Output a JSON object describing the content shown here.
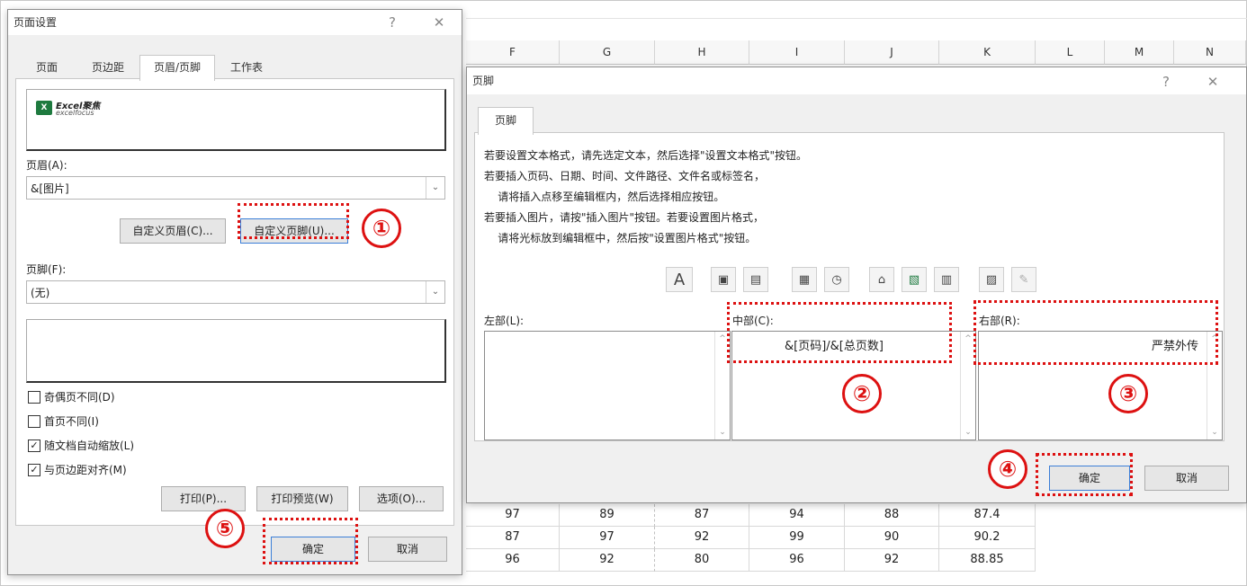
{
  "spreadsheet": {
    "columns": [
      "F",
      "G",
      "H",
      "I",
      "J",
      "K",
      "L",
      "M",
      "N"
    ],
    "rows": [
      [
        "97",
        "89",
        "87",
        "94",
        "88",
        "87.4"
      ],
      [
        "87",
        "97",
        "92",
        "99",
        "90",
        "90.2"
      ],
      [
        "96",
        "92",
        "80",
        "96",
        "92",
        "88.85"
      ]
    ]
  },
  "page_setup": {
    "title": "页面设置",
    "help": "?",
    "close": "✕",
    "tabs": [
      "页面",
      "页边距",
      "页眉/页脚",
      "工作表"
    ],
    "active_tab": "页眉/页脚",
    "logo_text": "Excel聚焦",
    "logo_sub": "excelfocus",
    "header_label": "页眉(A):",
    "header_value": "&[图片]",
    "custom_header_btn": "自定义页眉(C)...",
    "custom_footer_btn": "自定义页脚(U)...",
    "footer_label": "页脚(F):",
    "footer_value": "(无)",
    "checkboxes": [
      {
        "label": "奇偶页不同(D)",
        "checked": false
      },
      {
        "label": "首页不同(I)",
        "checked": false
      },
      {
        "label": "随文档自动缩放(L)",
        "checked": true
      },
      {
        "label": "与页边距对齐(M)",
        "checked": true
      }
    ],
    "check_mark": "✓",
    "print_btn": "打印(P)...",
    "preview_btn": "打印预览(W)",
    "options_btn": "选项(O)...",
    "ok_btn": "确定",
    "cancel_btn": "取消"
  },
  "footer_dialog": {
    "title": "页脚",
    "help": "?",
    "close": "✕",
    "tab": "页脚",
    "instructions": [
      "若要设置文本格式，请先选定文本，然后选择\"设置文本格式\"按钮。",
      "若要插入页码、日期、时间、文件路径、文件名或标签名，",
      "    请将插入点移至编辑框内，然后选择相应按钮。",
      "若要插入图片，请按\"插入图片\"按钮。若要设置图片格式，",
      "    请将光标放到编辑框中，然后按\"设置图片格式\"按钮。"
    ],
    "toolbar": [
      {
        "name": "format-text-icon",
        "glyph": "A"
      },
      {
        "name": "page-number-icon",
        "glyph": "▣"
      },
      {
        "name": "page-count-icon",
        "glyph": "▤"
      },
      {
        "name": "date-icon",
        "glyph": "▦"
      },
      {
        "name": "time-icon",
        "glyph": "◷"
      },
      {
        "name": "file-path-icon",
        "glyph": "⌂"
      },
      {
        "name": "file-name-icon",
        "glyph": "▧"
      },
      {
        "name": "sheet-name-icon",
        "glyph": "▥"
      },
      {
        "name": "insert-picture-icon",
        "glyph": "▨"
      },
      {
        "name": "format-picture-icon",
        "glyph": "✎"
      }
    ],
    "left_label": "左部(L):",
    "center_label": "中部(C):",
    "right_label": "右部(R):",
    "left_value": "",
    "center_value": "&[页码]/&[总页数]",
    "right_value": "严禁外传",
    "ok_btn": "确定",
    "cancel_btn": "取消"
  },
  "annotations": [
    "①",
    "②",
    "③",
    "④",
    "⑤"
  ],
  "colors": {
    "annotation": "#d11111",
    "primary_border": "#3c7fd8"
  }
}
